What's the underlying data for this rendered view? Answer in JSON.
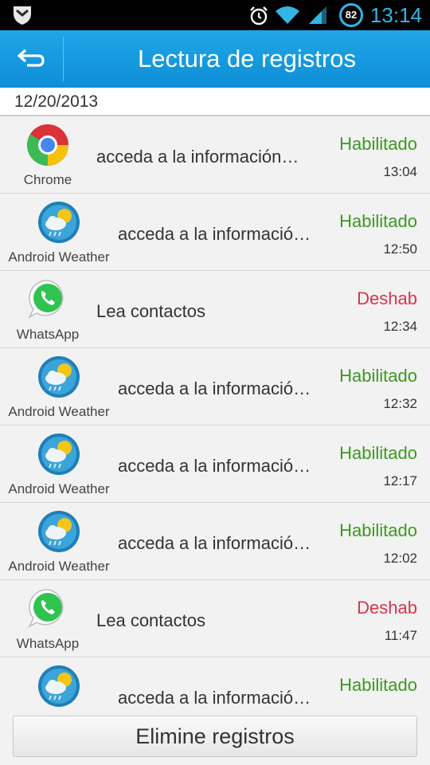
{
  "status_bar": {
    "battery": "82",
    "time": "13:14"
  },
  "header": {
    "title": "Lectura de registros"
  },
  "date": "12/20/2013",
  "rows": [
    {
      "app": "Chrome",
      "icon": "chrome-icon",
      "permission": "acceda a la información…",
      "status": "Habilitado",
      "time": "13:04"
    },
    {
      "app": "Android Weather",
      "icon": "android-weather-icon",
      "permission": "acceda a la informació…",
      "status": "Habilitado",
      "time": "12:50"
    },
    {
      "app": "WhatsApp",
      "icon": "whatsapp-icon",
      "permission": "Lea contactos",
      "status": "Deshab",
      "time": "12:34"
    },
    {
      "app": "Android Weather",
      "icon": "android-weather-icon",
      "permission": "acceda a la informació…",
      "status": "Habilitado",
      "time": "12:32"
    },
    {
      "app": "Android Weather",
      "icon": "android-weather-icon",
      "permission": "acceda a la informació…",
      "status": "Habilitado",
      "time": "12:17"
    },
    {
      "app": "Android Weather",
      "icon": "android-weather-icon",
      "permission": "acceda a la informació…",
      "status": "Habilitado",
      "time": "12:02"
    },
    {
      "app": "WhatsApp",
      "icon": "whatsapp-icon",
      "permission": "Lea contactos",
      "status": "Deshab",
      "time": "11:47"
    },
    {
      "app": "Android Weather",
      "icon": "android-weather-icon",
      "permission": "acceda a la informació…",
      "status": "Habilitado",
      "time": ""
    }
  ],
  "actions": {
    "delete_label": "Elimine registros"
  },
  "colors": {
    "enabled": "#3a9a1e",
    "disabled": "#d9344a",
    "accent": "#1a9be0"
  }
}
